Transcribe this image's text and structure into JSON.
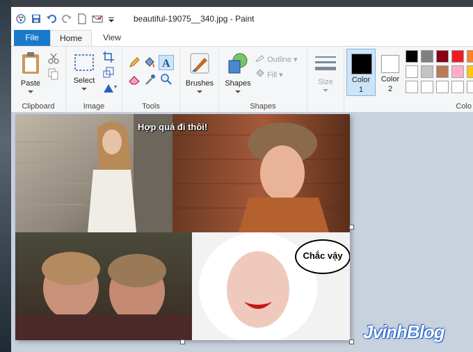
{
  "window": {
    "title": "beautiful-19075__340.jpg - Paint"
  },
  "tabs": {
    "file": "File",
    "home": "Home",
    "view": "View"
  },
  "clipboard": {
    "paste": "Paste",
    "label": "Clipboard"
  },
  "image_group": {
    "select": "Select",
    "label": "Image"
  },
  "tools": {
    "label": "Tools"
  },
  "brushes": {
    "label": "Brushes"
  },
  "shapes_group": {
    "shapes": "Shapes",
    "outline": "Outline",
    "fill": "Fill",
    "label": "Shapes"
  },
  "size": {
    "label": "Size"
  },
  "colors": {
    "color1": "Color",
    "color1_num": "1",
    "color2": "Color",
    "color2_num": "2",
    "label": "Colo",
    "palette_row1": [
      "#000000",
      "#7f7f7f",
      "#880015",
      "#ed1c24",
      "#ff7f27"
    ],
    "palette_row2": [
      "#ffffff",
      "#c3c3c3",
      "#b97a57",
      "#ffaec9",
      "#ffc90e"
    ],
    "palette_row3": [
      "#ffffff",
      "#ffffff",
      "#ffffff",
      "#ffffff",
      "#ffffff"
    ]
  },
  "canvas": {
    "caption_top": "Hợp quá đi thôi!",
    "bubble_text": "Chắc vậy"
  },
  "watermark": "JvinhBlog"
}
